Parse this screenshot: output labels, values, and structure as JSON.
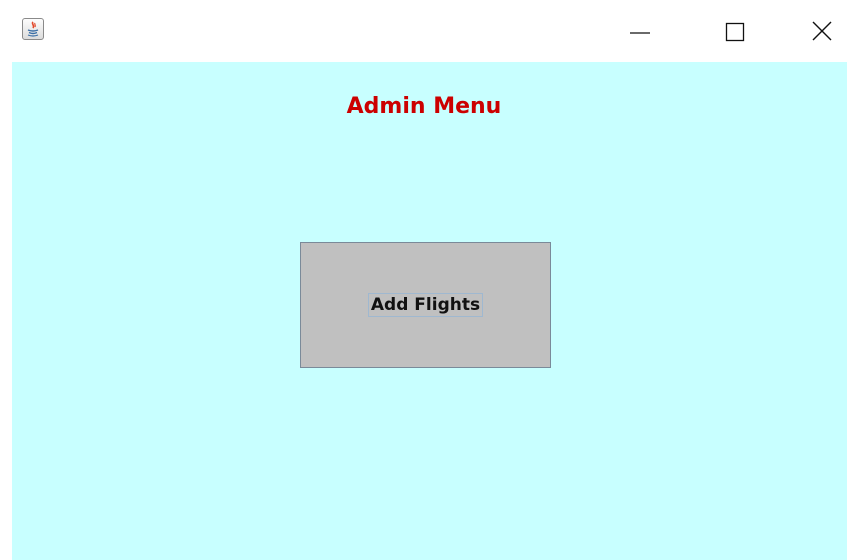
{
  "window": {
    "app_icon": "java-icon",
    "controls": [
      {
        "name": "minimize",
        "icon": "minimize-icon"
      },
      {
        "name": "maximize",
        "icon": "maximize-icon"
      },
      {
        "name": "close",
        "icon": "close-icon"
      }
    ]
  },
  "content": {
    "background_color": "#c8ffff",
    "title": "Admin Menu",
    "title_color": "#cc0000",
    "add_flights_label": "Add Flights",
    "button_color": "#c0c0c0"
  }
}
